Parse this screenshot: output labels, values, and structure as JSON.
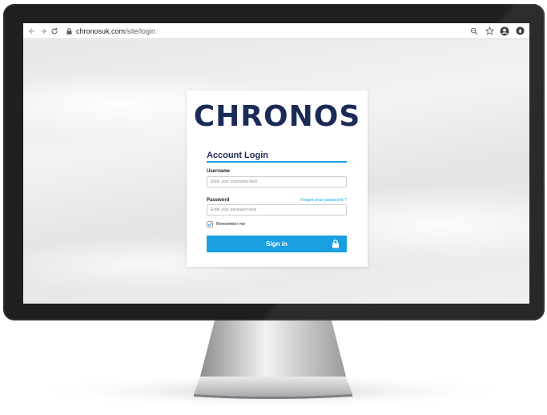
{
  "browser": {
    "url_host": "chronosuk.com",
    "url_path": "/site/login"
  },
  "login": {
    "brand": "CHRONOS",
    "title": "Account Login",
    "username_label": "Username",
    "username_placeholder": "Enter your username here",
    "password_label": "Password",
    "password_placeholder": "Enter your password here",
    "forgot_link": "Forgot your password ?",
    "remember_label": "Remember me",
    "remember_checked": true,
    "signin_label": "Sign in"
  },
  "colors": {
    "brand_navy": "#1c2a56",
    "accent_blue": "#1aa0e0",
    "bezel": "#1f1f21"
  },
  "icons": [
    "back-arrow-icon",
    "forward-arrow-icon",
    "reload-icon",
    "lock-icon",
    "zoom-icon",
    "star-icon",
    "account-icon",
    "extension-icon",
    "checkmark-icon",
    "padlock-icon"
  ]
}
